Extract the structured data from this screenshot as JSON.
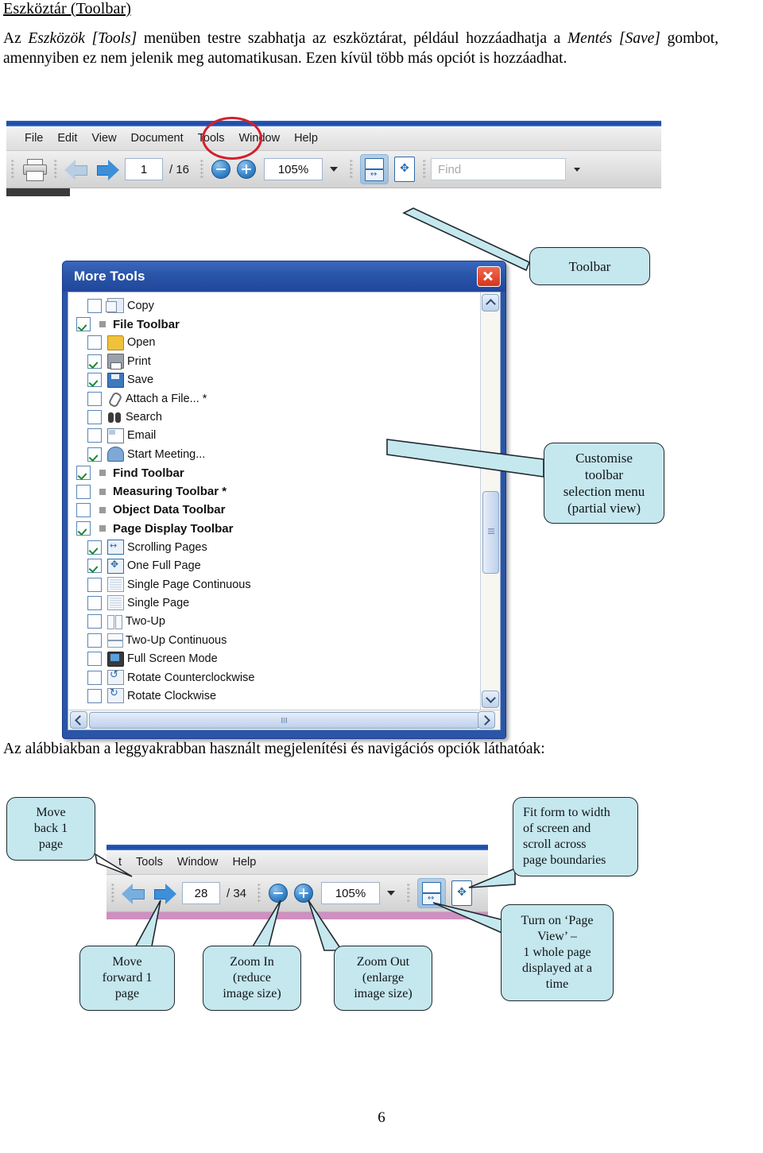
{
  "document": {
    "heading": "Eszköztár (Toolbar)",
    "paragraph1_parts": [
      {
        "text": "Az ",
        "style": "normal"
      },
      {
        "text": "Eszközök [Tools]",
        "style": "italic"
      },
      {
        "text": " menüben testre szabhatja az eszköztárat, például hozzáadhatja a ",
        "style": "normal"
      },
      {
        "text": "Mentés [Save]",
        "style": "italic"
      },
      {
        "text": " gombot, amennyiben ez nem jelenik meg automatikusan. Ezen kívül több más opciót is hozzáadhat.",
        "style": "normal"
      }
    ],
    "paragraph2": "Az alábbiakban a leggyakrabban használt megjelenítési és navigációs opciók láthatóak:",
    "page_number": "6"
  },
  "toolbar_top": {
    "menus": [
      "File",
      "Edit",
      "View",
      "Document",
      "Tools",
      "Window",
      "Help"
    ],
    "highlighted_menu": "Tools",
    "print_icon": "printer-icon",
    "prev_page_icon": "arrow-left-icon",
    "next_page_icon": "arrow-right-icon",
    "current_page": "1",
    "page_total": "/ 16",
    "zoom_out_icon": "minus-circle-icon",
    "zoom_in_icon": "plus-circle-icon",
    "zoom_value": "105%",
    "fit_width_icon": "fit-width-icon",
    "fit_page_icon": "fit-page-icon",
    "find_placeholder": "Find"
  },
  "dialog": {
    "title": "More Tools",
    "close_icon": "close-icon",
    "items": [
      {
        "label": "Copy",
        "checked": false,
        "level": "item",
        "icon": "copy-icon"
      },
      {
        "label": "File Toolbar",
        "checked": true,
        "level": "group",
        "icon": "group-bullet"
      },
      {
        "label": "Open",
        "checked": false,
        "level": "item",
        "icon": "folder-icon"
      },
      {
        "label": "Print",
        "checked": true,
        "level": "item",
        "icon": "printer-icon"
      },
      {
        "label": "Save",
        "checked": true,
        "level": "item",
        "icon": "save-icon"
      },
      {
        "label": "Attach a File... *",
        "checked": false,
        "level": "item",
        "icon": "paperclip-icon"
      },
      {
        "label": "Search",
        "checked": false,
        "level": "item",
        "icon": "binoculars-icon"
      },
      {
        "label": "Email",
        "checked": false,
        "level": "item",
        "icon": "email-icon"
      },
      {
        "label": "Start Meeting...",
        "checked": true,
        "level": "item",
        "icon": "meeting-icon"
      },
      {
        "label": "Find Toolbar",
        "checked": true,
        "level": "group",
        "icon": "group-bullet"
      },
      {
        "label": "Measuring Toolbar *",
        "checked": false,
        "level": "group",
        "icon": "group-bullet"
      },
      {
        "label": "Object Data Toolbar",
        "checked": false,
        "level": "group",
        "icon": "group-bullet"
      },
      {
        "label": "Page Display Toolbar",
        "checked": true,
        "level": "group",
        "icon": "group-bullet"
      },
      {
        "label": "Scrolling Pages",
        "checked": true,
        "level": "item",
        "icon": "scrolling-pages-icon"
      },
      {
        "label": "One Full Page",
        "checked": true,
        "level": "item",
        "icon": "one-full-page-icon"
      },
      {
        "label": "Single Page Continuous",
        "checked": false,
        "level": "item",
        "icon": "single-page-continuous-icon"
      },
      {
        "label": "Single Page",
        "checked": false,
        "level": "item",
        "icon": "single-page-icon"
      },
      {
        "label": "Two-Up",
        "checked": false,
        "level": "item",
        "icon": "two-up-icon"
      },
      {
        "label": "Two-Up Continuous",
        "checked": false,
        "level": "item",
        "icon": "two-up-continuous-icon"
      },
      {
        "label": "Full Screen Mode",
        "checked": false,
        "level": "item",
        "icon": "full-screen-icon"
      },
      {
        "label": "Rotate Counterclockwise",
        "checked": false,
        "level": "item",
        "icon": "rotate-ccw-icon"
      },
      {
        "label": "Rotate Clockwise",
        "checked": false,
        "level": "item",
        "icon": "rotate-cw-icon"
      }
    ]
  },
  "toolbar_bottom": {
    "menus": [
      "t",
      "Tools",
      "Window",
      "Help"
    ],
    "prev_page_icon": "arrow-left-icon",
    "next_page_icon": "arrow-right-icon",
    "current_page": "28",
    "page_total": "/ 34",
    "zoom_out_icon": "minus-circle-icon",
    "zoom_in_icon": "plus-circle-icon",
    "zoom_value": "105%",
    "fit_width_icon": "fit-width-icon",
    "fit_page_icon": "fit-page-icon"
  },
  "callouts": {
    "toolbar": "Toolbar",
    "customise": "Customise\ntoolbar\nselection menu\n(partial view)",
    "move_back": "Move\nback 1\npage",
    "move_forward": "Move\nforward 1\npage",
    "zoom_in": "Zoom In\n(reduce\nimage size)",
    "zoom_out": "Zoom Out\n(enlarge\nimage size)",
    "fit_width": "Fit form to width\nof screen and\nscroll across\npage boundaries",
    "page_view": "Turn on ‘Page\nView’ –\n1 whole page\ndisplayed  at a\ntime"
  },
  "colors": {
    "callout_fill": "#c5e7ee",
    "dialog_blue": "#2a55a8",
    "highlight_red": "#d3212c",
    "accent_blue": "#3d8fd8",
    "check_green": "#1a8a2e"
  }
}
